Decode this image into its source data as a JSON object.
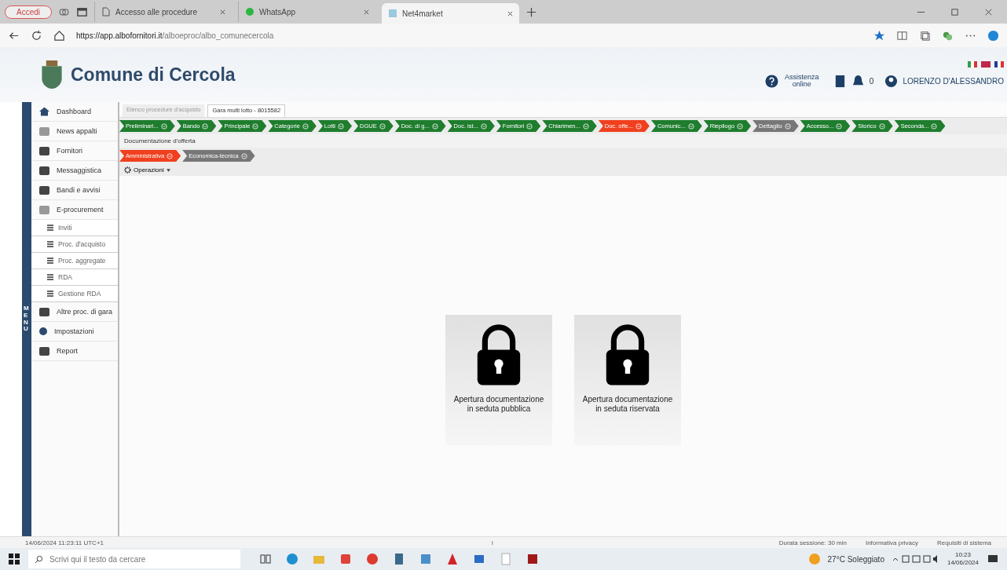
{
  "browser": {
    "profile": "Accedi",
    "tabs": [
      {
        "label": "Accesso alle procedure",
        "kind": "page",
        "selected": false
      },
      {
        "label": "WhatsApp",
        "kind": "whatsapp",
        "selected": false
      },
      {
        "label": "Net4market",
        "kind": "site",
        "selected": true
      }
    ],
    "url_host": "https://app.albofornitori.it",
    "url_path": "/alboeproc/albo_comunecercola"
  },
  "header": {
    "title": "Comune di Cercola",
    "help": "Assistenza online",
    "notifications": "0",
    "user": "LORENZO D'ALESSANDRO"
  },
  "sidebar": {
    "label": "MENU",
    "items": [
      {
        "label": "Dashboard"
      },
      {
        "label": "News appalti"
      },
      {
        "label": "Fornitori"
      },
      {
        "label": "Messaggistica"
      },
      {
        "label": "Bandi e avvisi"
      },
      {
        "label": "E-procurement",
        "children": [
          {
            "label": "Inviti"
          },
          {
            "label": "Proc. d'acquisto"
          },
          {
            "label": "Proc. aggregate"
          },
          {
            "label": "RDA"
          },
          {
            "label": "Gestione RDA"
          }
        ]
      },
      {
        "label": "Altre proc. di gara"
      },
      {
        "label": "Impostazioni"
      },
      {
        "label": "Report"
      }
    ]
  },
  "page_tabs": [
    {
      "label": "Elenco procedure d'acquisto",
      "selected": false
    },
    {
      "label": "Gara multi lotto - 8015582",
      "selected": true
    }
  ],
  "steps": [
    {
      "label": "Preliminari...",
      "selected": false,
      "disabled": false
    },
    {
      "label": "Bando",
      "selected": false,
      "disabled": false
    },
    {
      "label": "Principale",
      "selected": false,
      "disabled": false
    },
    {
      "label": "Categorie",
      "selected": false,
      "disabled": false
    },
    {
      "label": "Lotti",
      "selected": false,
      "disabled": false
    },
    {
      "label": "DGUE",
      "selected": false,
      "disabled": false
    },
    {
      "label": "Doc. di g...",
      "selected": false,
      "disabled": false
    },
    {
      "label": "Doc. ist...",
      "selected": false,
      "disabled": false
    },
    {
      "label": "Fornitori",
      "selected": false,
      "disabled": false
    },
    {
      "label": "Chiarimen...",
      "selected": false,
      "disabled": false
    },
    {
      "label": "Doc. offe...",
      "selected": true,
      "disabled": false
    },
    {
      "label": "Comunic...",
      "selected": false,
      "disabled": false
    },
    {
      "label": "Riepilogo",
      "selected": false,
      "disabled": false
    },
    {
      "label": "Dettaglio",
      "selected": false,
      "disabled": true
    },
    {
      "label": "Accesso...",
      "selected": false,
      "disabled": false
    },
    {
      "label": "Storico",
      "selected": false,
      "disabled": false
    },
    {
      "label": "Seconda...",
      "selected": false,
      "disabled": false
    }
  ],
  "section_title": "Documentazione d'offerta",
  "sub_steps": [
    {
      "label": "Amministrativa",
      "selected": true,
      "disabled": false
    },
    {
      "label": "Economica-tecnica",
      "selected": false,
      "disabled": true
    }
  ],
  "operations": "Operazioni",
  "cards": [
    "Apertura documentazione in seduta pubblica",
    "Apertura documentazione in seduta riservata"
  ],
  "footer": {
    "timestamp": "14/06/2024 11:23:11 UTC+1",
    "mark": "i",
    "session": "Durata sessione: 30 min",
    "privacy": "Informativa privacy",
    "requirements": "Requisiti di sistema"
  },
  "taskbar": {
    "placeholder": "Scrivi qui il testo da cercare",
    "weather": "27°C Soleggiato",
    "time": "10:23",
    "date": "14/06/2024"
  }
}
